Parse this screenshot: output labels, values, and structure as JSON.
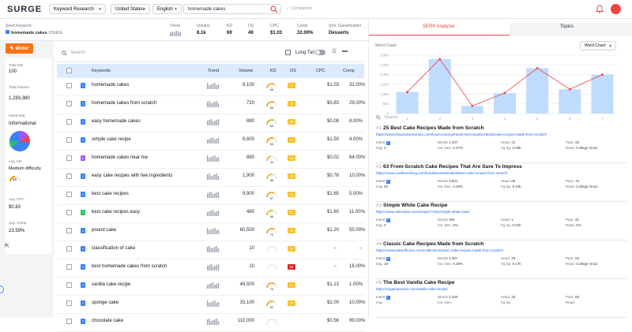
{
  "app": {
    "logo": "SURGE",
    "tool": "Keyword Research",
    "country": "United States",
    "language": "English",
    "query": "homemade cakes",
    "status": "Completed",
    "accent": "#f97316"
  },
  "seed": {
    "label": "Seed Keyword",
    "value": "homemade cakes",
    "locale": "US/EN",
    "metrics": [
      {
        "label": "Trend",
        "value": ""
      },
      {
        "label": "Volume",
        "value": "8.1k"
      },
      {
        "label": "KD",
        "value": "69"
      },
      {
        "label": "OS",
        "value": "49"
      },
      {
        "label": "CPC",
        "value": "$1.03"
      },
      {
        "label": "Comp",
        "value": "32.00%"
      },
      {
        "label": "Smt. Classification",
        "value": "Desserts"
      }
    ]
  },
  "left": {
    "writer": "Writer",
    "total_kw_label": "Total KW",
    "total_kw": "100",
    "total_vol_label": "Total Volume",
    "total_vol": "1,283,380",
    "intent_label": "Intent Dist.",
    "intent_value": "Informational",
    "avg_kd_label": "Avg. KD",
    "avg_kd_text": "Medium difficulty",
    "avg_kd": "46",
    "avg_cpc_label": "Avg. CPC",
    "avg_cpc": "$0.83",
    "avg_comp_label": "Avg. Comp.",
    "avg_comp": "23.59%"
  },
  "table": {
    "search_placeholder": "Search",
    "longtail": "Long Tail",
    "headers": {
      "keywords": "Keywords",
      "trend": "Trend",
      "volume": "Volume",
      "kd": "KD",
      "os": "OS",
      "cpc": "CPC",
      "comp": "Comp"
    },
    "rows": [
      {
        "intent": "I",
        "kw": "homemade cakes",
        "volume": "8,100",
        "kd": "69",
        "os": "41",
        "cpc": "$1.03",
        "comp": "32.00%"
      },
      {
        "intent": "I",
        "kw": "homemade cakes from scratch",
        "volume": "720",
        "kd": "69",
        "os": "42",
        "cpc": "$0.83",
        "comp": "29.00%"
      },
      {
        "intent": "I",
        "kw": "easy homemade cakes",
        "volume": "880",
        "kd": "64",
        "os": "46",
        "cpc": "$0.08",
        "comp": "8.00%"
      },
      {
        "intent": "I",
        "kw": "simple cake recipe",
        "volume": "6,600",
        "kd": "64",
        "os": "46",
        "cpc": "$1.50",
        "comp": "4.00%"
      },
      {
        "intent": "L",
        "kw": "homemade cakes near me",
        "volume": "880",
        "kd": "44",
        "os": "51",
        "cpc": "$0.02",
        "comp": "64.00%"
      },
      {
        "intent": "I",
        "kw": "easy cake recipes with few ingredients",
        "volume": "1,900",
        "kd": "55",
        "os": "45",
        "cpc": "$0.76",
        "comp": "10.00%"
      },
      {
        "intent": "I",
        "kw": "best cake recipes",
        "volume": "9,900",
        "kd": "67",
        "os": "54",
        "cpc": "$1.65",
        "comp": "5.00%"
      },
      {
        "intent": "T",
        "kw": "best cake recipes easy",
        "volume": "480",
        "kd": "58",
        "os": "51",
        "cpc": "$1.60",
        "comp": "11.00%"
      },
      {
        "intent": "I",
        "kw": "pound cake",
        "volume": "60,500",
        "kd": "70",
        "os": "40",
        "cpc": "$1.20",
        "comp": "55.00%"
      },
      {
        "intent": "I",
        "kw": "classification of cake",
        "volume": "10",
        "kd": "",
        "os": "37",
        "cpc": "–",
        "comp": "–"
      },
      {
        "intent": "I",
        "kw": "best homemade cakes from scratch",
        "volume": "10",
        "kd": "",
        "os": "24",
        "cpc": "–",
        "comp": "18.00%"
      },
      {
        "intent": "I",
        "kw": "vanilla cake recipe",
        "volume": "49,500",
        "kd": "70",
        "os": "41",
        "cpc": "$1.13",
        "comp": "1.00%"
      },
      {
        "intent": "I",
        "kw": "sponge cake",
        "volume": "33,100",
        "kd": "62",
        "os": "37",
        "cpc": "$2.00",
        "comp": "10.00%"
      },
      {
        "intent": "I",
        "kw": "chocolate cake",
        "volume": "110,000",
        "kd": "",
        "os": "",
        "cpc": "$0.56",
        "comp": "99.00%"
      }
    ]
  },
  "serp": {
    "tab1": "SERP Analyzer",
    "tab2": "Topics",
    "wc_label": "Word Count",
    "wc_select": "Word Count",
    "search_placeholder": "Search",
    "results": [
      {
        "rank": "#1",
        "title": "25 Best Cake Recipes Made from Scratch",
        "url": "https://www.thepioneerwoman.com/food-cooking/meals-menus/g36179016/cake-recipes-made-from-scratch/",
        "intent": "I",
        "words": "1,107",
        "head": "21",
        "para": "33",
        "img": "4",
        "kwden": "0.27%",
        "fgsp": "0.08k",
        "read": "College Grad."
      },
      {
        "rank": "#2",
        "title": "63 From-Scratch Cake Recipes That Are Sure To Impress",
        "url": "https://www.southernliving.com/food/desserts/cakes/best-cake-recipes-from-scratch",
        "intent": "I",
        "words": "2,801",
        "head": "65",
        "para": "76",
        "img": "63",
        "kwden": "0.28%",
        "fgsp": "9.44k",
        "read": "College Grad."
      },
      {
        "rank": "#3",
        "title": "Simple White Cake Recipe",
        "url": "https://www.allrecipes.com/recipe/17481/simple-white-cake/",
        "intent": "I",
        "words": "394",
        "head": "1",
        "para": "31",
        "img": "0",
        "kwden": "0%",
        "fgsp": "0.22k",
        "read": "0%"
      },
      {
        "rank": "#4",
        "title": "Classic Cake Recipes Made from Scratch",
        "url": "https://www.tasteofhome.com/collection/classic-cake-recipes-made-from-scratch/",
        "intent": "I",
        "words": "1,057",
        "head": "25",
        "para": "63",
        "img": "18",
        "kwden": "0.38%",
        "fgsp": "9.17k",
        "read": "College Grad."
      },
      {
        "rank": "#5",
        "title": "The Best Vanilla Cake Recipe",
        "url": "https://sugarspunrun.com/vanilla-cake-recipe/",
        "intent": "I",
        "words": "2,330",
        "head": "19",
        "para": "59",
        "img": "",
        "kwden": "",
        "fgsp": "",
        "read": ""
      }
    ]
  },
  "chart_data": {
    "type": "bar",
    "categories": [
      "1",
      "2",
      "3",
      "4",
      "5",
      "6",
      "7"
    ],
    "values": [
      1107,
      2801,
      394,
      1057,
      2330,
      1250,
      2000
    ],
    "line": [
      1107,
      2801,
      394,
      1057,
      2330,
      1250,
      2000
    ],
    "ylim": [
      0,
      3000
    ],
    "yticks": [
      "0",
      "500",
      "1,000",
      "1,500",
      "2,000",
      "2,500",
      "3,000"
    ],
    "bar_color": "#bfdbfe",
    "line_color": "#ef4444"
  }
}
